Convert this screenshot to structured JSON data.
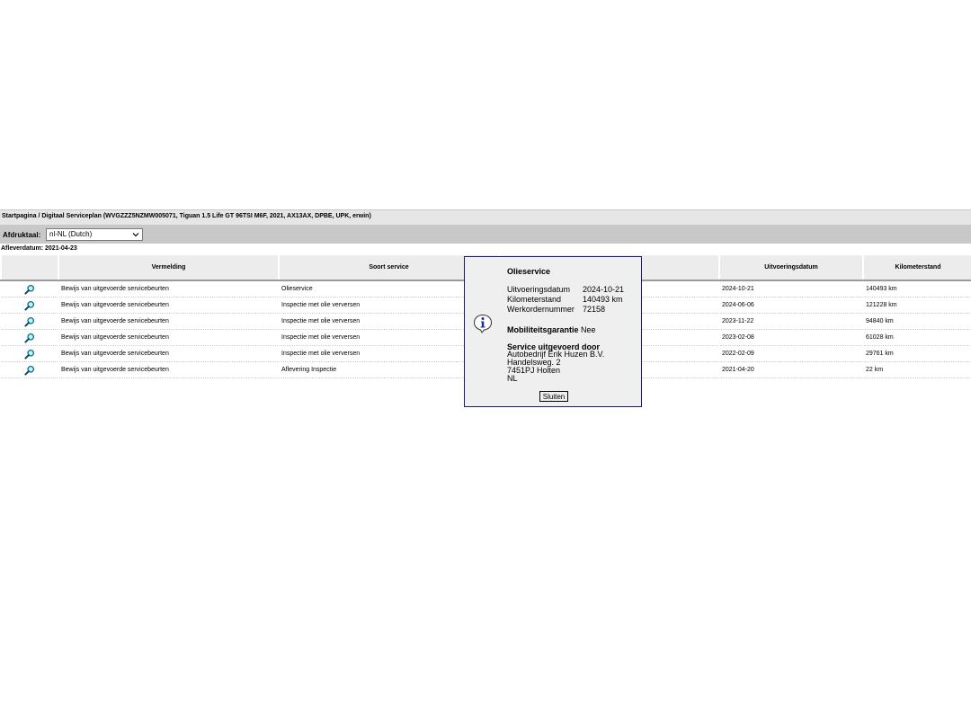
{
  "breadcrumb": "Startpagina / Digitaal Serviceplan (WVGZZZ5NZMW005071, Tiguan 1.5 Life GT 96TSI M6F, 2021, AX13AX, DPBE, UPK, erwin)",
  "language": {
    "label": "Afdruktaal:",
    "selected": "nl-NL (Dutch)"
  },
  "delivery_date": "Afleverdatum: 2021-04-23",
  "table": {
    "headers": [
      "",
      "Vermelding",
      "Soort service",
      "",
      "Uitvoeringsdatum",
      "Kilometerstand"
    ],
    "rows": [
      {
        "icon": "magnifier-icon",
        "entry": "Bewijs van uitgevoerde servicebeurten",
        "type": "Olieservice",
        "date": "2024-10-21",
        "km": "140493 km"
      },
      {
        "icon": "magnifier-icon",
        "entry": "Bewijs van uitgevoerde servicebeurten",
        "type": "Inspectie met olie verversen",
        "date": "2024-06-06",
        "km": "121228 km"
      },
      {
        "icon": "magnifier-icon",
        "entry": "Bewijs van uitgevoerde servicebeurten",
        "type": "Inspectie met olie verversen",
        "date": "2023-11-22",
        "km": "94840 km"
      },
      {
        "icon": "magnifier-icon",
        "entry": "Bewijs van uitgevoerde servicebeurten",
        "type": "Inspectie met olie verversen",
        "date": "2023-02-08",
        "km": "61028 km"
      },
      {
        "icon": "magnifier-icon",
        "entry": "Bewijs van uitgevoerde servicebeurten",
        "type": "Inspectie met olie verversen",
        "date": "2022-02-09",
        "km": "29761 km"
      },
      {
        "icon": "magnifier-icon",
        "entry": "Bewijs van uitgevoerde servicebeurten",
        "type": "Aflevering Inspectie",
        "date": "2021-04-20",
        "km": "22 km"
      }
    ]
  },
  "popup": {
    "icon": "info-icon",
    "title": "Olieservice",
    "details": [
      {
        "label": "Uitvoeringsdatum",
        "value": "2024-10-21"
      },
      {
        "label": "Kilometerstand",
        "value": "140493 km"
      },
      {
        "label": "Werkordernummer",
        "value": "72158"
      }
    ],
    "mobility_label": "Mobiliteitsgarantie",
    "mobility_value": "Nee",
    "performed_by_label": "Service uitgevoerd door",
    "address": [
      "Autobedrijf Erik Huzen B.V.",
      "Handelsweg. 2",
      "7451PJ Holten",
      "NL"
    ],
    "close_label": "Sluiten"
  },
  "colors": {
    "popup_border": "#1a1a7a",
    "header_bg": "#ececec",
    "lang_bar_bg": "#c8c8c8"
  }
}
